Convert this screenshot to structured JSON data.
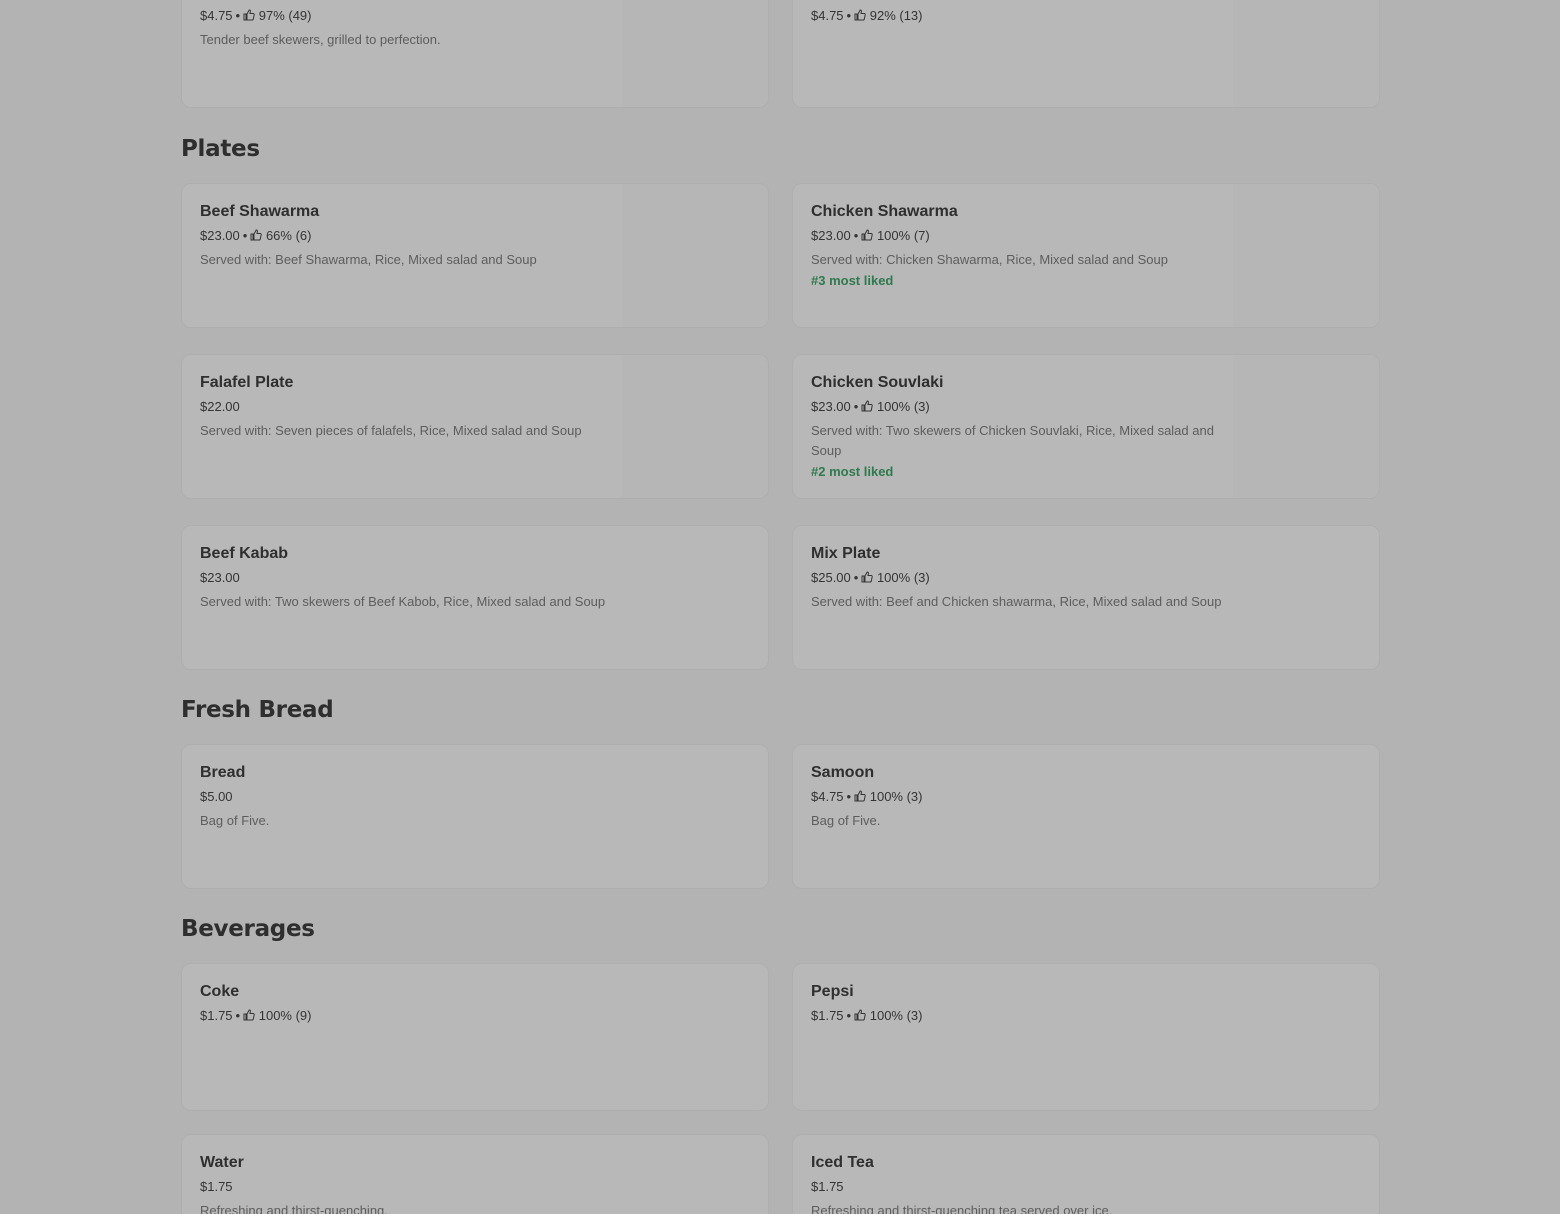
{
  "sections": {
    "top": {
      "items": [
        {
          "price": "$4.75",
          "rating": "97% (49)",
          "desc": "Tender beef skewers, grilled to perfection."
        },
        {
          "price": "$4.75",
          "rating": "92% (13)"
        }
      ]
    },
    "plates": {
      "title": "Plates",
      "items": [
        {
          "name": "Beef Shawarma",
          "price": "$23.00",
          "rating": "66% (6)",
          "desc": "Served with: Beef Shawarma, Rice, Mixed salad and Soup"
        },
        {
          "name": "Chicken Shawarma",
          "price": "$23.00",
          "rating": "100% (7)",
          "desc": "Served with: Chicken Shawarma, Rice, Mixed salad and Soup",
          "badge": "#3 most liked"
        },
        {
          "name": "Falafel Plate",
          "price": "$22.00",
          "desc": "Served with: Seven pieces of falafels, Rice, Mixed salad and Soup"
        },
        {
          "name": "Chicken Souvlaki",
          "price": "$23.00",
          "rating": "100% (3)",
          "desc": "Served with: Two skewers of Chicken Souvlaki, Rice, Mixed salad and Soup",
          "badge": "#2 most liked"
        },
        {
          "name": "Beef Kabab",
          "price": "$23.00",
          "desc": "Served with: Two skewers of Beef Kabob, Rice, Mixed salad and Soup"
        },
        {
          "name": "Mix Plate",
          "price": "$25.00",
          "rating": "100% (3)",
          "desc": "Served with: Beef and Chicken shawarma, Rice, Mixed salad and Soup"
        }
      ]
    },
    "bread": {
      "title": "Fresh Bread",
      "items": [
        {
          "name": "Bread",
          "price": "$5.00",
          "desc": "Bag of Five."
        },
        {
          "name": "Samoon",
          "price": "$4.75",
          "rating": "100% (3)",
          "desc": "Bag of Five."
        }
      ]
    },
    "beverages": {
      "title": "Beverages",
      "items": [
        {
          "name": "Coke",
          "price": "$1.75",
          "rating": "100% (9)"
        },
        {
          "name": "Pepsi",
          "price": "$1.75",
          "rating": "100% (3)"
        },
        {
          "name": "Water",
          "price": "$1.75",
          "desc": "Refreshing and thirst-quenching."
        },
        {
          "name": "Iced Tea",
          "price": "$1.75",
          "desc": "Refreshing and thirst-quenching tea served over ice."
        }
      ]
    }
  },
  "separator": "•",
  "icons": {
    "rating": "thumbs-up-icon"
  },
  "colors": {
    "badge": "#2f7a4e",
    "overlay": "#b3b3b3"
  }
}
